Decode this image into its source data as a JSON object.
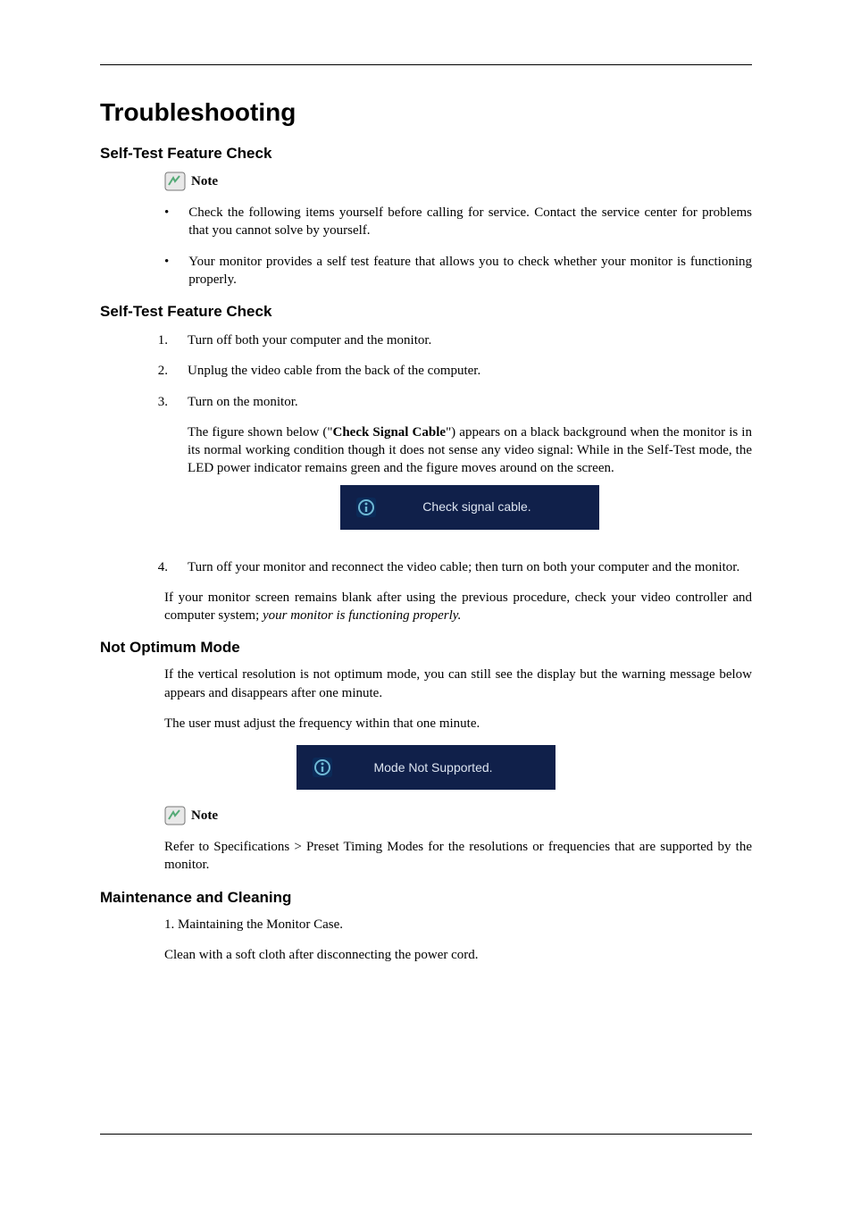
{
  "title": "Troubleshooting",
  "section1": {
    "heading": "Self-Test Feature Check",
    "note_label": "Note",
    "bullets": [
      "Check the following items yourself before calling for service. Contact the service center for problems that you cannot solve by yourself.",
      "Your monitor provides a self test feature that allows you to check whether your monitor is functioning properly."
    ]
  },
  "section2": {
    "heading": "Self-Test Feature Check",
    "steps": {
      "1": "Turn off both your computer and the monitor.",
      "2": "Unplug the video cable from the back of the computer.",
      "3": "Turn on the monitor.",
      "3_para_a": "The figure shown below (\"",
      "3_para_bold": "Check Signal Cable",
      "3_para_b": "\") appears on a black background when the monitor is in its normal working condition though it does not sense any video signal: While in the Self-Test mode, the LED power indicator remains green and the figure moves around on the screen.",
      "figure1_text": "Check signal cable.",
      "4": "Turn off your monitor and reconnect the video cable; then turn on both your computer and the monitor."
    },
    "closing_a": "If your monitor screen remains blank after using the previous procedure, check your video controller and computer system; ",
    "closing_italic": "your monitor is functioning properly."
  },
  "section3": {
    "heading": "Not Optimum Mode",
    "para1": "If the vertical resolution is not optimum mode, you can still see the display but the warning message below appears and disappears after one minute.",
    "para2": "The user must adjust the frequency within that one minute.",
    "figure2_text": "Mode Not Supported.",
    "note_label": "Note",
    "note_para": "Refer to Specifications > Preset Timing Modes for the resolutions or frequencies that are supported by the monitor."
  },
  "section4": {
    "heading": "Maintenance and Cleaning",
    "para1": "1. Maintaining the Monitor Case.",
    "para2": "Clean with a soft cloth after disconnecting the power cord."
  }
}
